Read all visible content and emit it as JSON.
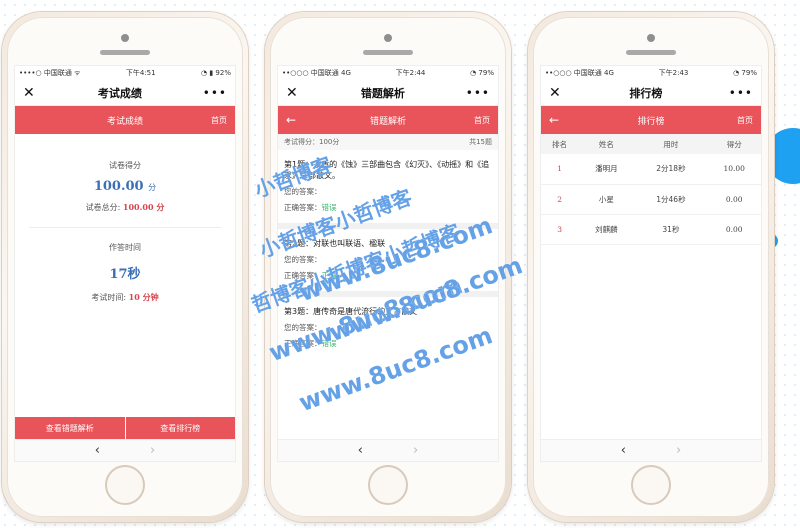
{
  "phone1": {
    "status": {
      "carrier": "••••○ 中国联通 ᯤ",
      "time": "下午4:51",
      "battery": "◔ ▮ 92%"
    },
    "title": "考试成绩",
    "close": "✕",
    "more": "•••",
    "redbar": {
      "title": "考试成绩",
      "home": "首页"
    },
    "score_label": "试卷得分",
    "score_value": "100.00",
    "score_unit": "分",
    "total_label": "试卷总分:",
    "total_value": "100.00 分",
    "time_label": "作答时间",
    "time_value": "17秒",
    "exam_time_label": "考试时间:",
    "exam_time_value": "10 分钟",
    "btn_review": "查看错题解析",
    "btn_rank": "查看排行榜",
    "nav_back": "‹",
    "nav_fwd": "›"
  },
  "phone2": {
    "status": {
      "carrier": "••○○○ 中国联通 4G",
      "time": "下午2:44",
      "battery": "◔ 79%"
    },
    "title": "错题解析",
    "close": "✕",
    "more": "•••",
    "redbar": {
      "back": "←",
      "title": "错题解析",
      "home": "首页"
    },
    "meta_left": "考试得分：100分",
    "meta_right": "共15题",
    "questions": [
      {
        "text": "第1题：茅盾的《蚀》三部曲包含《幻灭》、《动摇》和《追求》三部散文。",
        "answer_label": "您的答案：",
        "answer": "",
        "correct_label": "正确答案：",
        "correct": "错误"
      },
      {
        "text": "第2题：对联也叫联语、楹联",
        "answer_label": "您的答案：",
        "answer": "",
        "correct_label": "正确答案：",
        "correct": "正确"
      },
      {
        "text": "第3题：唐传奇是唐代流行的文言散文",
        "answer_label": "您的答案：",
        "answer": "",
        "correct_label": "正确答案：",
        "correct": "错误"
      }
    ],
    "nav_back": "‹",
    "nav_fwd": "›"
  },
  "phone3": {
    "status": {
      "carrier": "••○○○ 中国联通 4G",
      "time": "下午2:43",
      "battery": "◔ 79%"
    },
    "title": "排行榜",
    "close": "✕",
    "more": "•••",
    "redbar": {
      "back": "←",
      "title": "排行榜",
      "home": "首页"
    },
    "columns": [
      "排名",
      "姓名",
      "用时",
      "得分"
    ],
    "rows": [
      {
        "rank": "1",
        "name": "潘明月",
        "time": "2分18秒",
        "score": "10.00"
      },
      {
        "rank": "2",
        "name": "小星",
        "time": "1分46秒",
        "score": "0.00"
      },
      {
        "rank": "3",
        "name": "刘麒麟",
        "time": "31秒",
        "score": "0.00"
      }
    ],
    "nav_back": "‹",
    "nav_fwd": "›"
  },
  "watermark": {
    "line_a": "小哲博客",
    "line_b": "小哲博客小哲博客",
    "line_c": "哲博客小哲博客小哲博客",
    "url1": "www.8uc8.com",
    "url2": "www.8uc8.com",
    "url3": "www.8uc8.com",
    "url4": "www.8uc8.com"
  },
  "colors": {
    "accent": "#e9535a",
    "score_blue": "#3b6fb6",
    "green": "#39b36b",
    "watermark": "#4a90e2"
  }
}
